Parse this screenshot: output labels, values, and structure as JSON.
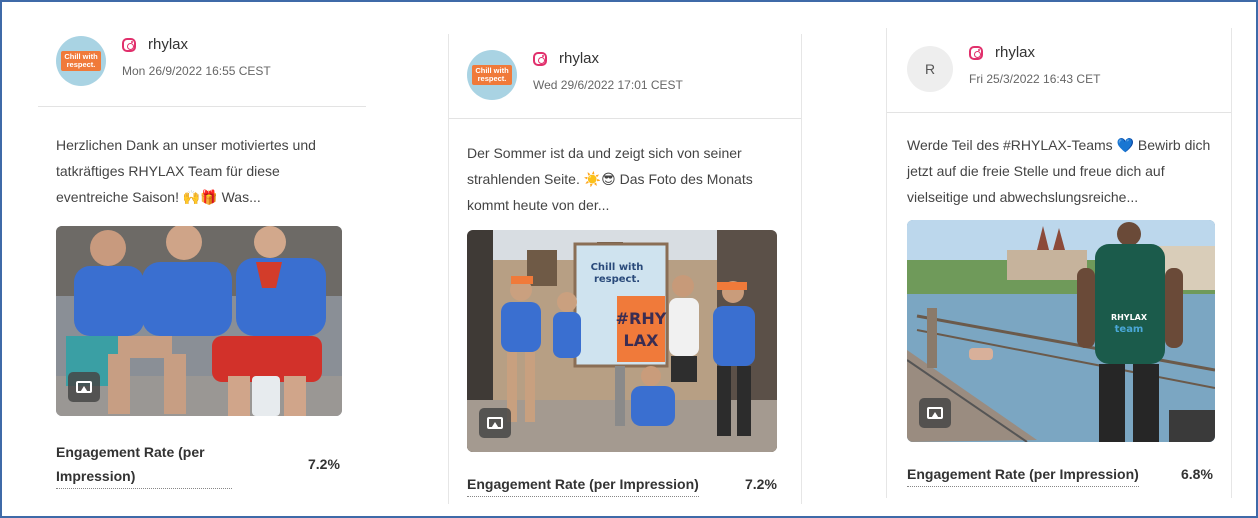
{
  "posts": [
    {
      "account": "rhylax",
      "date": "Mon 26/9/2022 16:55 CEST",
      "text": "Herzlichen Dank an unser motiviertes und tatkräftiges RHYLAX Team für diese eventreiche Saison! 🙌🎁  Was...",
      "avatar_badge": "Chill with respect.",
      "metric_label": "Engagement Rate (per Impression)",
      "metric_value": "7.2%"
    },
    {
      "account": "rhylax",
      "date": "Wed 29/6/2022 17:01 CEST",
      "text": "Der Sommer ist da und zeigt sich von seiner strahlenden Seite. ☀️😎  Das Foto des Monats kommt heute von der...",
      "avatar_badge": "Chill with respect.",
      "metric_label": "Engagement Rate (per Impression)",
      "metric_value": "7.2%"
    },
    {
      "account": "rhylax",
      "date": "Fri 25/3/2022 16:43 CET",
      "text": "Werde Teil des #RHYLAX-Teams 💙  Bewirb dich jetzt auf die freie Stelle und freue dich auf vielseitige und abwechslungsreiche...",
      "avatar_letter": "R",
      "metric_label": "Engagement Rate (per Impression)",
      "metric_value": "6.8%"
    }
  ],
  "photo2_sign": {
    "line1": "Chill with",
    "line2": "respect.",
    "tag1": "#RHY",
    "tag2": "LAX"
  },
  "photo3_shirt": {
    "line1": "RHYLAX",
    "line2": "team"
  },
  "icons": [
    "instagram-icon",
    "image-icon"
  ],
  "colors": {
    "frame": "#3f6aa8",
    "instagram": "#e1306c",
    "brand_orange": "#f07a3a",
    "shirt_blue": "#3a6fd0"
  }
}
